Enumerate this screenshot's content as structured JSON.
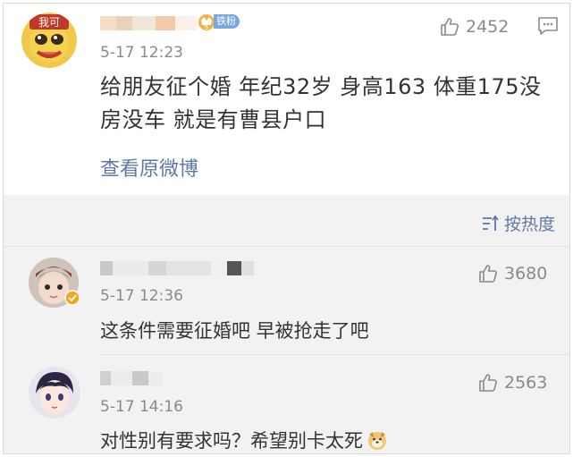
{
  "post": {
    "user_avatar_badge": "我可",
    "fan_label": "铁粉",
    "time": "5-17 12:23",
    "text_line1": "给朋友征个婚 年纪32岁 身高163 体重175没",
    "text_line2": "房没车 就是有曹县户口",
    "view_original": "查看原微博",
    "likes": "2452"
  },
  "sort": {
    "label": "按热度"
  },
  "comments": [
    {
      "time": "5-17 12:36",
      "text": "这条件需要征婚吧 早被抢走了吧",
      "likes": "3680"
    },
    {
      "time": "5-17 14:16",
      "text": "对性别有要求吗？希望别卡太死",
      "likes": "2563"
    }
  ],
  "icons": {
    "like": "thumbs-up-icon",
    "comment": "comment-icon",
    "sort": "sort-icon",
    "verified": "verified-badge-icon",
    "emoji": "dog-emoji-icon"
  },
  "colors": {
    "link": "#5d79a8",
    "comment_bg": "#f2f2f2",
    "badge": "#7aa7e0"
  }
}
